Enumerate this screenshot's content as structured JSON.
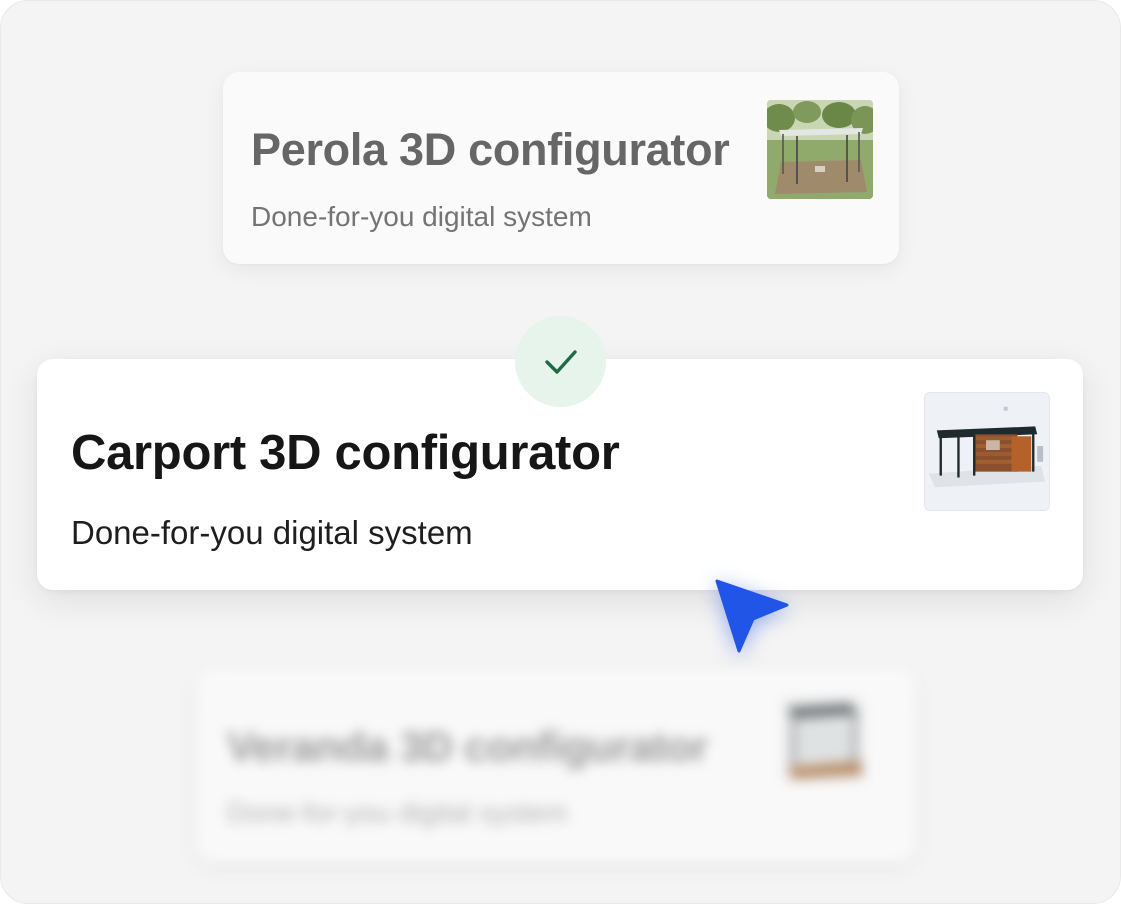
{
  "cards": [
    {
      "title": "Perola 3D configurator",
      "subtitle": "Done-for-you digital system",
      "thumbnail_icon": "pergola-render-image",
      "state": "default"
    },
    {
      "title": "Carport 3D configurator",
      "subtitle": "Done-for-you digital system",
      "thumbnail_icon": "carport-render-image",
      "state": "selected"
    },
    {
      "title": "Veranda 3D configurator",
      "subtitle": "Done-for-you digital system",
      "thumbnail_icon": "veranda-render-image",
      "state": "blurred"
    }
  ],
  "selection_badge": {
    "icon": "checkmark-icon"
  },
  "pointer": {
    "icon": "cursor-arrow-icon"
  },
  "colors": {
    "background": "#f4f4f4",
    "card": "#ffffff",
    "check_badge_bg": "#e6f4ec",
    "check_mark": "#1f6b45",
    "cursor": "#2155e8"
  }
}
